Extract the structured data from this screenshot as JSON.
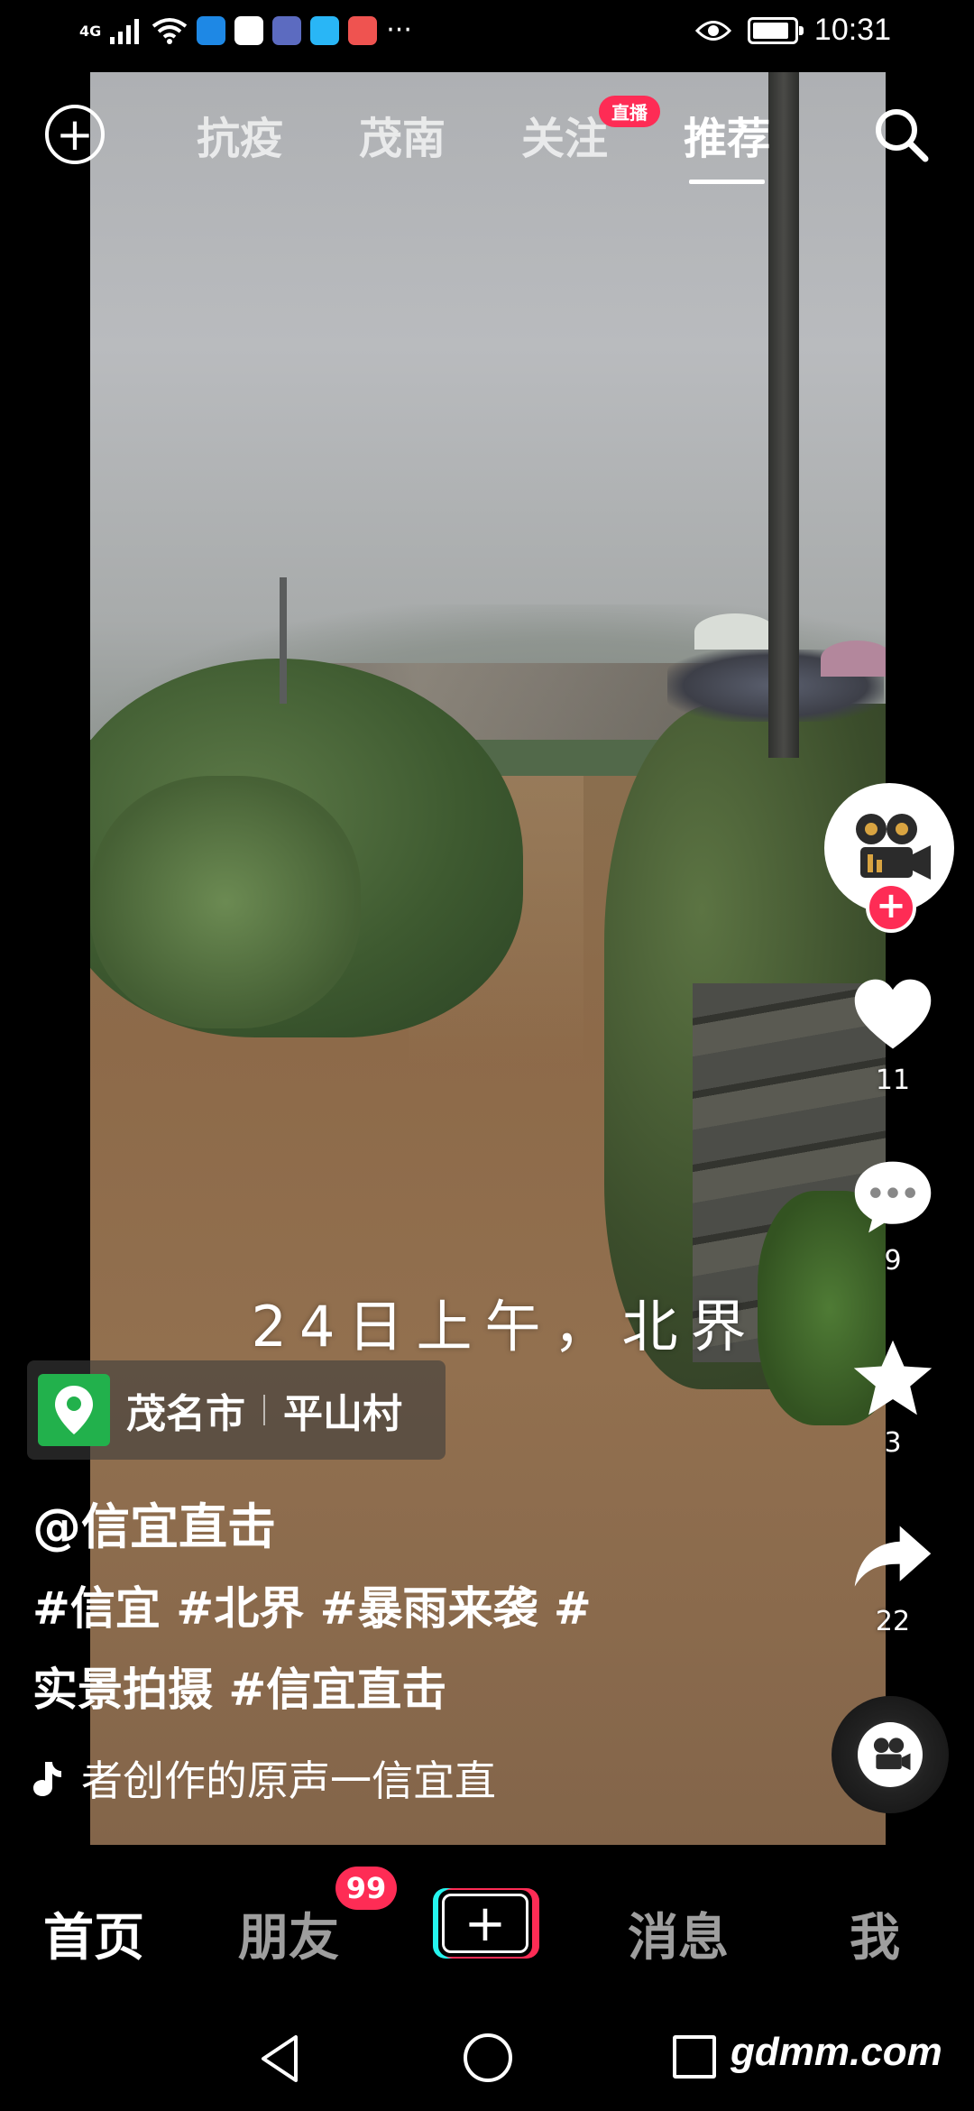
{
  "status_bar": {
    "network": "4G",
    "time": "10:31"
  },
  "top_tabs": {
    "tabs": [
      "抗疫",
      "茂南",
      "关注",
      "推荐"
    ],
    "active": "推荐",
    "live_badge": "直播"
  },
  "video": {
    "overlay_caption": "24日上午，北界"
  },
  "right_rail": {
    "likes": "11",
    "comments": "9",
    "favorites": "3",
    "shares": "22"
  },
  "location": {
    "city": "茂名市",
    "place": "平山村"
  },
  "post": {
    "author": "@信宜直击",
    "description_line1": "#信宜 #北界 #暴雨来袭 #",
    "description_line2": "实景拍摄 #信宜直击",
    "music": "者创作的原声一信宜直"
  },
  "bottom_tabs": {
    "home": "首页",
    "friends": "朋友",
    "friends_badge": "99",
    "create": "+",
    "messages": "消息",
    "me": "我"
  },
  "watermark": "gdmm.com",
  "colors": {
    "accent_red": "#fe2c55",
    "accent_cyan": "#25f4ee",
    "location_green": "#22b14c"
  }
}
